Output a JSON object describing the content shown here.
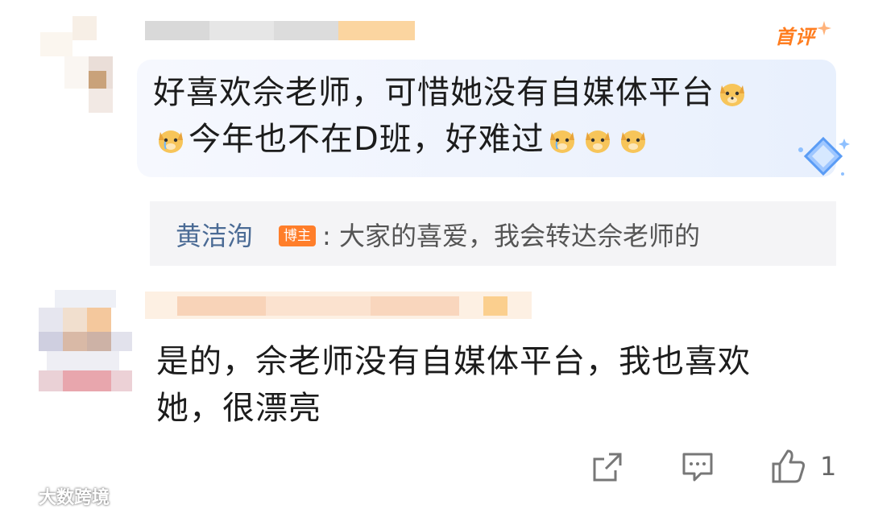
{
  "comments": [
    {
      "text_line1": "好喜欢佘老师，可惜她没有自媒体平台",
      "text_line2": "今年也不在D班，好难过",
      "badge": "首评",
      "reply": {
        "author": "黄洁洵",
        "author_tag": "博主",
        "text": ": 大家的喜爱，我会转达佘老师的"
      }
    },
    {
      "text_line1": "是的，佘老师没有自媒体平台，我也喜欢",
      "text_line2": "她，很漂亮"
    }
  ],
  "actions": {
    "like_count": "1"
  },
  "icons": [
    "share-icon",
    "comment-icon",
    "like-icon",
    "diamond-icon",
    "dog-emoji-icon"
  ],
  "colors": {
    "badge_orange": "#ff7d1f",
    "reply_author": "#4b6b95",
    "blogger_tag": "#ff7e2a"
  },
  "watermark": "大数跨境"
}
